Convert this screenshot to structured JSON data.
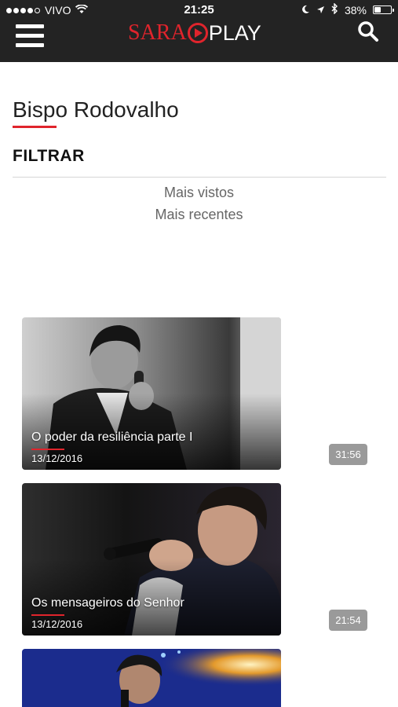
{
  "status_bar": {
    "carrier": "VIVO",
    "time": "21:25",
    "battery": "38%",
    "battery_level": 0.38,
    "icons": [
      "signal-dots-icon",
      "wifi-icon",
      "moon-icon",
      "location-arrow-icon",
      "bluetooth-icon",
      "battery-icon"
    ]
  },
  "header": {
    "logo_sara": "SARA",
    "logo_play": "PLAY",
    "brand_color": "#e0242c",
    "background": "#232323",
    "icons": [
      "menu-icon",
      "search-icon"
    ]
  },
  "page": {
    "title": "Bispo Rodovalho",
    "filter_label": "FILTRAR",
    "filter_options": [
      "Mais vistos",
      "Mais recentes"
    ]
  },
  "videos": [
    {
      "title": "O poder da resiliência parte I",
      "date": "13/12/2016",
      "duration": "31:56"
    },
    {
      "title": "Os mensageiros do Senhor",
      "date": "13/12/2016",
      "duration": "21:54"
    },
    {
      "title": "",
      "date": "",
      "duration": ""
    }
  ]
}
